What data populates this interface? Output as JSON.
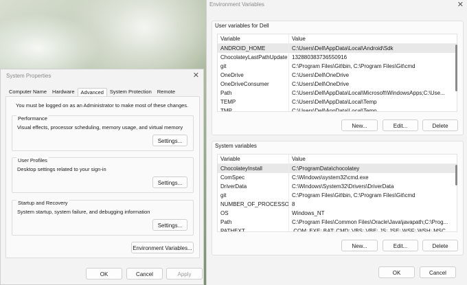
{
  "env_window": {
    "title": "Environment Variables",
    "user_group_title": "User variables for Dell",
    "system_group_title": "System variables",
    "columns": [
      "Variable",
      "Value"
    ],
    "user_rows": [
      {
        "name": "ANDROID_HOME",
        "value": "C:\\Users\\Dell\\AppData\\Local\\Android\\Sdk",
        "selected": true
      },
      {
        "name": "ChocolateyLastPathUpdate",
        "value": "132880383736550916"
      },
      {
        "name": "git",
        "value": "C:\\Program Files\\Git\\bin, C:\\Program Files\\Git\\cmd"
      },
      {
        "name": "OneDrive",
        "value": "C:\\Users\\Dell\\OneDrive"
      },
      {
        "name": "OneDriveConsumer",
        "value": "C:\\Users\\Dell\\OneDrive"
      },
      {
        "name": "Path",
        "value": "C:\\Users\\Dell\\AppData\\Local\\Microsoft\\WindowsApps;C:\\Use..."
      },
      {
        "name": "TEMP",
        "value": "C:\\Users\\Dell\\AppData\\Local\\Temp"
      },
      {
        "name": "TMP",
        "value": "C:\\Users\\Dell\\AppData\\Local\\Temp"
      }
    ],
    "system_rows": [
      {
        "name": "ChocolateyInstall",
        "value": "C:\\ProgramData\\chocolatey",
        "selected": true
      },
      {
        "name": "ComSpec",
        "value": "C:\\Windows\\system32\\cmd.exe"
      },
      {
        "name": "DriverData",
        "value": "C:\\Windows\\System32\\Drivers\\DriverData"
      },
      {
        "name": "git",
        "value": "C:\\Program Files\\Git\\bin, C:\\Program Files\\Git\\cmd"
      },
      {
        "name": "NUMBER_OF_PROCESSORS",
        "value": "8"
      },
      {
        "name": "OS",
        "value": "Windows_NT"
      },
      {
        "name": "Path",
        "value": "C:\\Program Files\\Common Files\\Oracle\\Java\\javapath;C:\\Prog..."
      },
      {
        "name": "PATHEXT",
        "value": ".COM;.EXE;.BAT;.CMD;.VBS;.VBE;.JS;.JSE;.WSF;.WSH;.MSC"
      }
    ],
    "buttons": {
      "new": "New...",
      "edit": "Edit...",
      "delete": "Delete",
      "ok": "OK",
      "cancel": "Cancel"
    }
  },
  "sys_window": {
    "title": "System Properties",
    "tabs": [
      "Computer Name",
      "Hardware",
      "Advanced",
      "System Protection",
      "Remote"
    ],
    "active_tab": "Advanced",
    "admin_note": "You must be logged on as an Administrator to make most of these changes.",
    "performance": {
      "title": "Performance",
      "desc": "Visual effects, processor scheduling, memory usage, and virtual memory",
      "button": "Settings..."
    },
    "user_profiles": {
      "title": "User Profiles",
      "desc": "Desktop settings related to your sign-in",
      "button": "Settings..."
    },
    "startup": {
      "title": "Startup and Recovery",
      "desc": "System startup, system failure, and debugging information",
      "button": "Settings..."
    },
    "env_button": "Environment Variables...",
    "ok": "OK",
    "cancel": "Cancel",
    "apply": "Apply"
  }
}
